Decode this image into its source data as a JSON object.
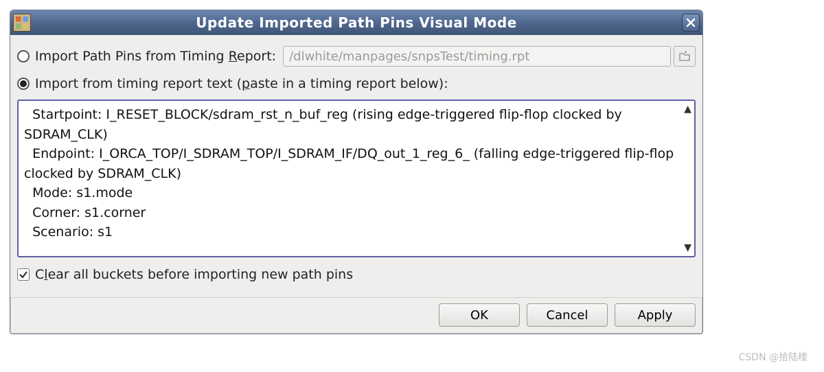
{
  "title": "Update Imported Path Pins Visual Mode",
  "option1": {
    "label_pre": "Import Path Pins from Timing ",
    "label_u": "R",
    "label_post": "eport:",
    "path_value": "/dlwhite/manpages/snpsTest/timing.rpt"
  },
  "option2": {
    "label_pre": "Import from timing report text (",
    "label_u": "p",
    "label_post": "aste in a timing report below):"
  },
  "report_text": "  Startpoint: I_RESET_BLOCK/sdram_rst_n_buf_reg (rising edge-triggered flip-flop clocked by SDRAM_CLK)\n  Endpoint: I_ORCA_TOP/I_SDRAM_TOP/I_SDRAM_IF/DQ_out_1_reg_6_ (falling edge-triggered flip-flop clocked by SDRAM_CLK)\n  Mode: s1.mode\n  Corner: s1.corner\n  Scenario: s1",
  "clear_checkbox": {
    "label_pre": "C",
    "label_u": "l",
    "label_post": "ear all buckets before importing new path pins",
    "checked": true
  },
  "buttons": {
    "ok": "OK",
    "cancel": "Cancel",
    "apply": "Apply"
  },
  "watermark": "CSDN @拾陆楼"
}
